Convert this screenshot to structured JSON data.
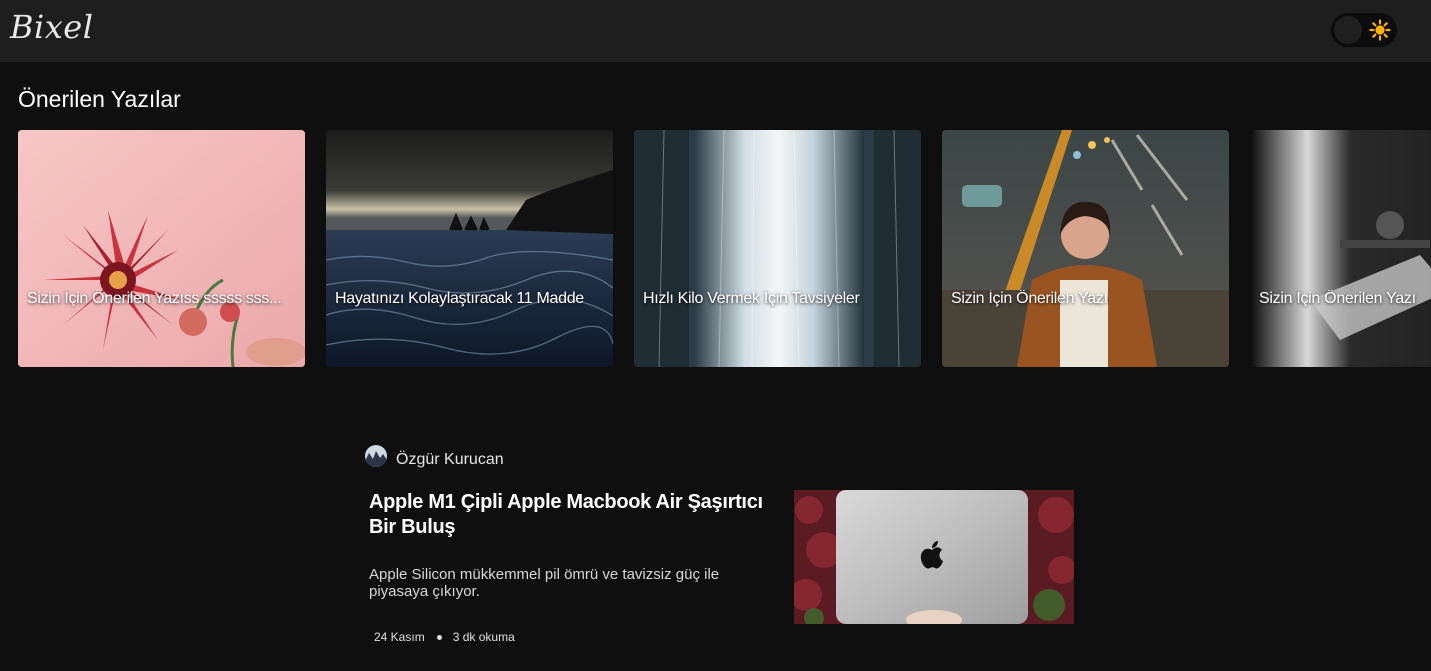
{
  "header": {
    "logo": "Bixel",
    "theme_toggle_icon": "sun-icon",
    "accent": "#ffb300"
  },
  "recommended": {
    "title": "Önerilen Yazılar",
    "cards": [
      {
        "title": "Sizin İçin Önerilen Yazıss sssss sss..."
      },
      {
        "title": "Hayatınızı Kolaylaştıracak 11 Madde"
      },
      {
        "title": "Hızlı Kilo Vermek İçin Tavsiyeler"
      },
      {
        "title": "Sizin İçin Önerilen Yazı"
      },
      {
        "title": "Sizin İçin Önerilen Yazı"
      }
    ]
  },
  "article": {
    "author": "Özgür Kurucan",
    "title": "Apple M1 Çipli Apple Macbook Air Şaşırtıcı Bir Buluş",
    "description": "Apple Silicon mükkemmel pil ömrü ve tavizsiz güç ile piyasaya çıkıyor.",
    "date": "24 Kasım",
    "read_time": "3 dk okuma"
  }
}
